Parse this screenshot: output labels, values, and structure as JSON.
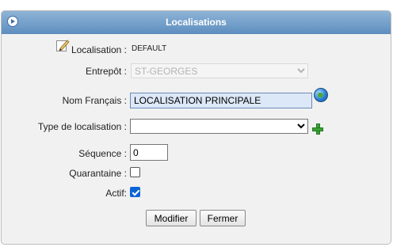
{
  "dialog": {
    "title": "Localisations",
    "titlebar_color": "#6f9bc9"
  },
  "form": {
    "localisation": {
      "label": "Localisation :",
      "value": "DEFAULT"
    },
    "entrepot": {
      "label": "Entrepôt :",
      "selected": "ST-GEORGES"
    },
    "nom_francais": {
      "label": "Nom Français :",
      "value": "LOCALISATION PRINCIPALE"
    },
    "type_localisation": {
      "label": "Type de localisation :",
      "selected": ""
    },
    "sequence": {
      "label": "Séquence :",
      "value": "0"
    },
    "quarantaine": {
      "label": "Quarantaine :",
      "checked": false
    },
    "actif": {
      "label": "Actif:",
      "checked": true
    }
  },
  "buttons": {
    "modifier": "Modifier",
    "fermer": "Fermer"
  },
  "icons": {
    "collapse": "collapse-arrow-icon",
    "edit": "pencil-edit-icon",
    "globe": "globe-icon",
    "add": "plus-icon"
  }
}
